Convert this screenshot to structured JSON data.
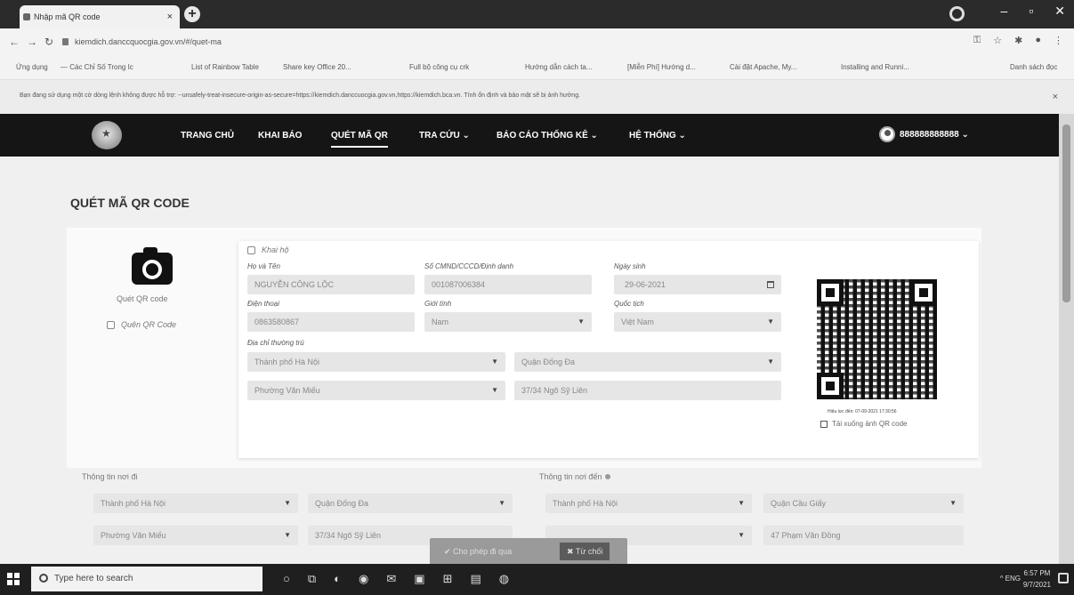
{
  "browser": {
    "tab_title": "Nhập mã QR code",
    "tab_close": "×",
    "new_tab": "+",
    "url": "kiemdich.danccquocgia.gov.vn/#/quet-ma",
    "bookmarks": [
      "Ứng dụng",
      "— Các Chỉ Số Trong Ic",
      "List of Rainbow Table",
      "Share key Office 20...",
      "Full bộ công cụ crk",
      "Hướng dẫn cách ta...",
      "[Miễn Phí] Hướng d...",
      "Cài đặt Apache, My...",
      "Installing and Runni...",
      "Danh sách đọc"
    ],
    "infobar_text": "Bạn đang sử dụng một cờ dòng lệnh không được hỗ trợ: --unsafely-treat-insecure-origin-as-secure=https://kiemdich.danccuocgia.gov.vn,https://kiemdich.bca.vn. Tính ổn định và bảo mật sẽ bị ảnh hưởng.",
    "infobar_close": "×"
  },
  "nav": {
    "items": [
      "TRANG CHỦ",
      "KHAI BÁO",
      "QUÉT MÃ QR",
      "TRA CỨU ⌄",
      "BÁO CÁO THỐNG KÊ ⌄",
      "HỆ THỐNG ⌄"
    ],
    "active_index": 2,
    "user": "888888888888 ⌄"
  },
  "page": {
    "title": "QUÉT MÃ QR CODE",
    "scan_label": "Quét QR code",
    "scan_qr_checkbox": "Quên QR Code",
    "khai_ho": "Khai hộ",
    "fields": {
      "ho_ten": {
        "label": "Họ và Tên",
        "value": "NGUYỄN CÔNG LỘC"
      },
      "cmnd": {
        "label": "Số CMND/CCCD/Định danh",
        "value": "001087006384"
      },
      "ngay_sinh": {
        "label": "Ngày sinh",
        "value": "29-06-2021"
      },
      "dien_thoai": {
        "label": "Điện thoại",
        "value": "0863580867"
      },
      "gioi_tinh": {
        "label": "Giới tính",
        "value": "Nam"
      },
      "quoc_tich": {
        "label": "Quốc tịch",
        "value": "Việt Nam"
      },
      "dia_chi_label": "Địa chỉ thường trú",
      "tinh": "Thành phố Hà Nội",
      "quan": "Quận Đống Đa",
      "phuong": "Phường Văn Miếu",
      "dia_chi": "37/34 Ngõ Sỹ Liên"
    },
    "qr_caption": "Hiệu lực đến: 07-09-2021 17:30:56",
    "qr_save": "Tải xuống ảnh QR code",
    "noi_di": {
      "label": "Thông tin nơi đi",
      "tinh": "Thành phố Hà Nội",
      "quan": "Quận Đống Đa",
      "phuong": "Phường Văn Miếu",
      "dia_chi": "37/34 Ngõ Sỹ Liên"
    },
    "noi_den": {
      "label": "Thông tin nơi đến",
      "tinh": "Thành phố Hà Nội",
      "quan": "Quận Cầu Giấy",
      "dia_chi": "47 Phạm Văn Đồng"
    },
    "btn_allow": "✔ Cho phép đi qua",
    "btn_reject": "✖ Từ chối"
  },
  "taskbar": {
    "search_placeholder": "Type here to search",
    "tray": "^ ENG",
    "time": "6:57 PM",
    "date": "9/7/2021"
  }
}
